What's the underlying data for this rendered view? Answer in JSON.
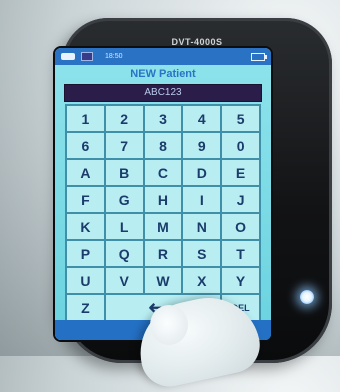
{
  "device": {
    "model_label": "DVT-4000S"
  },
  "status_bar": {
    "time": "18:50",
    "icons": [
      "network-icon",
      "indicator-icon",
      "battery-icon"
    ]
  },
  "screen": {
    "title": "NEW Patient",
    "input_value": "ABC123"
  },
  "keypad": {
    "keys": [
      "1",
      "2",
      "3",
      "4",
      "5",
      "6",
      "7",
      "8",
      "9",
      "0",
      "A",
      "B",
      "C",
      "D",
      "E",
      "F",
      "G",
      "H",
      "I",
      "J",
      "K",
      "L",
      "M",
      "N",
      "O",
      "P",
      "Q",
      "R",
      "S",
      "T",
      "U",
      "V",
      "W",
      "X",
      "Y",
      "Z"
    ],
    "backspace_label": "⟵",
    "delete_label": "DEL"
  },
  "bottom_bar": {
    "close_label": "✕"
  },
  "colors": {
    "screen_bg": "#7fdbe6",
    "status_bar": "#2a72c4",
    "key_bg": "#b8eef2",
    "key_text": "#1b3b6b",
    "title_text": "#2a73c6",
    "input_bg": "#2a1d4a"
  }
}
